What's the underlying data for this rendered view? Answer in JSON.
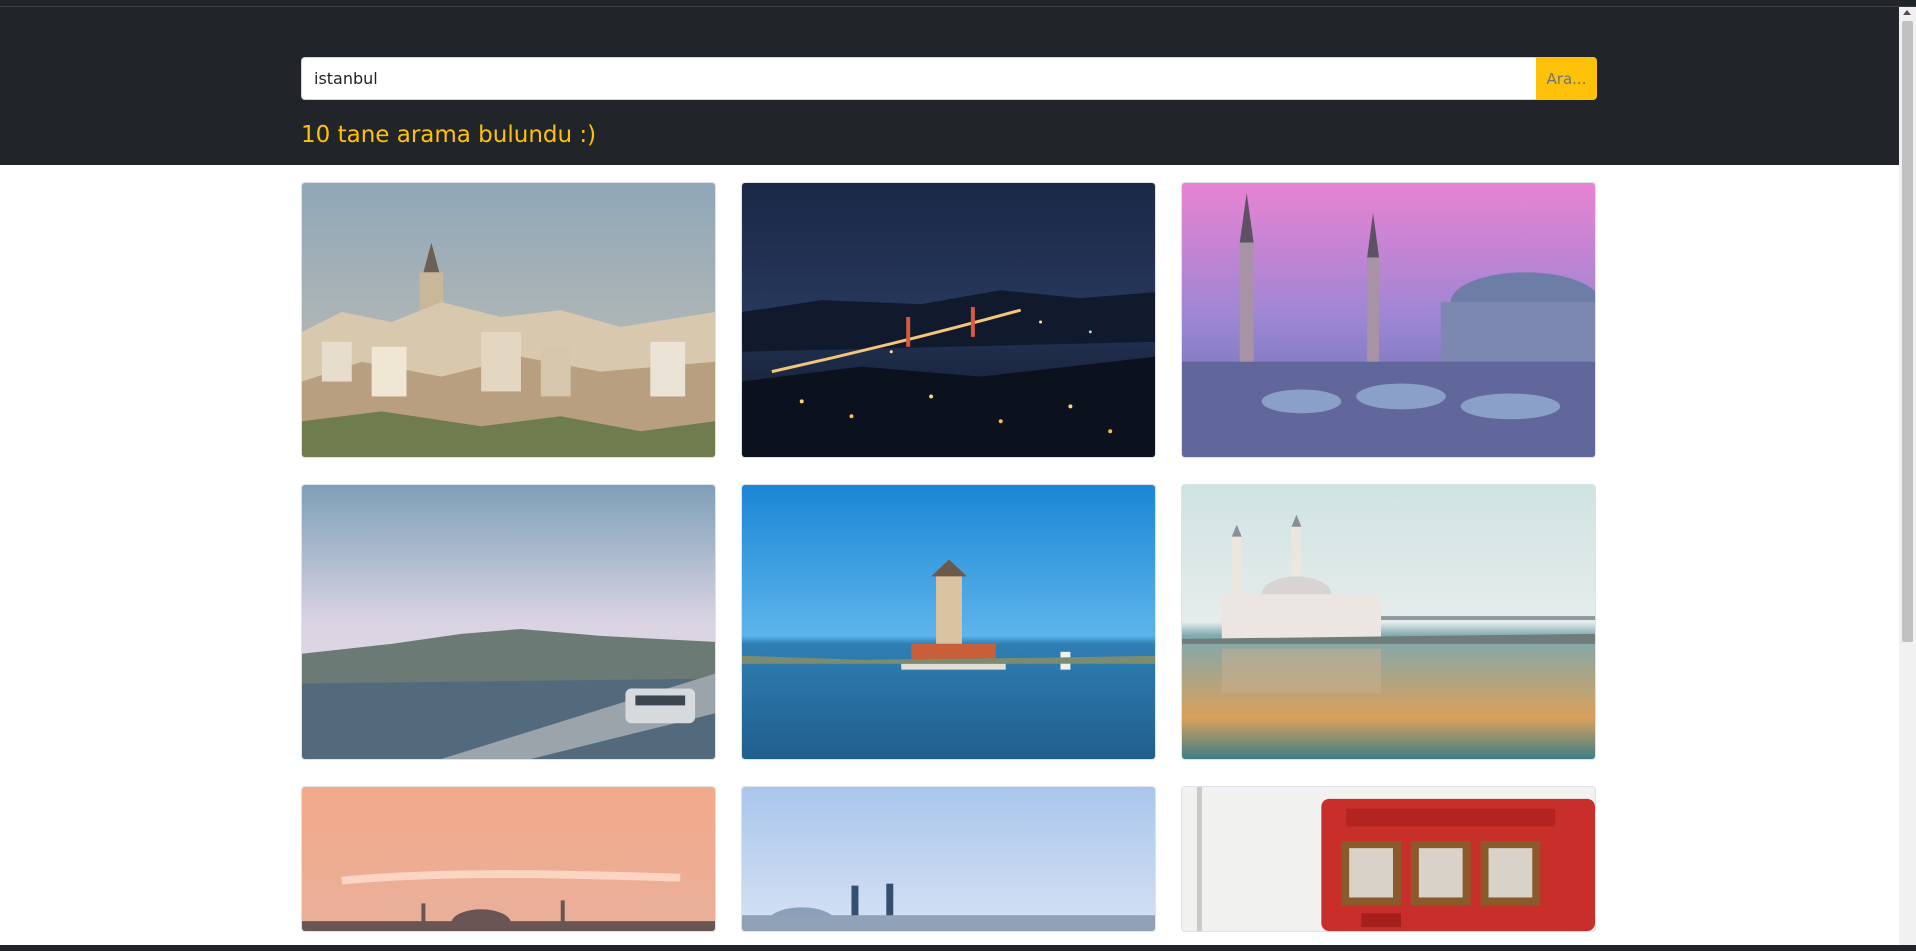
{
  "search": {
    "value": "istanbul",
    "button_label": "Ara..."
  },
  "results": {
    "summary": "10 tane arama bulundu :)"
  },
  "colors": {
    "header_bg": "#212529",
    "accent": "#ffc107"
  },
  "icons": {
    "scroll_up": "triangle-up"
  }
}
